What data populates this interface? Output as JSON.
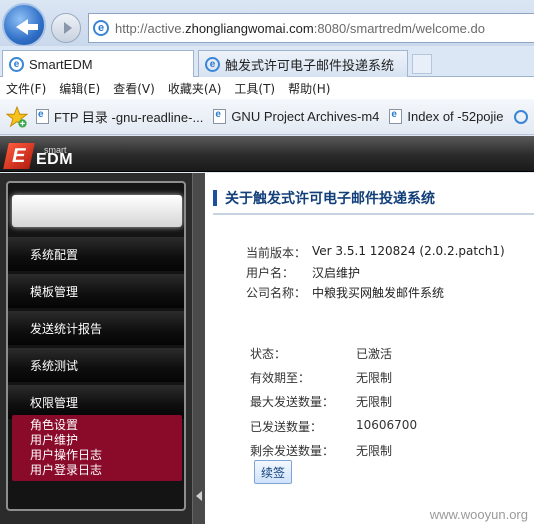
{
  "browser": {
    "url_prefix": "http://active.",
    "url_host": "zhongliangwomai.com",
    "url_suffix": ":8080/smartredm/welcome.do",
    "tabs": [
      {
        "label": "SmartEDM"
      },
      {
        "label": "触发式许可电子邮件投递系统"
      }
    ],
    "menu": [
      "文件(F)",
      "编辑(E)",
      "查看(V)",
      "收藏夹(A)",
      "工具(T)",
      "帮助(H)"
    ],
    "favorites": [
      {
        "label": "FTP 目录 -gnu-readline-..."
      },
      {
        "label": "GNU Project Archives-m4"
      },
      {
        "label": "Index of -52pojie"
      }
    ]
  },
  "header": {
    "logo_small": "smart",
    "logo_big": "EDM",
    "logo_mark": "E"
  },
  "sidebar": {
    "items": [
      {
        "label": "系统配置"
      },
      {
        "label": "模板管理"
      },
      {
        "label": "发送统计报告"
      },
      {
        "label": "系统测试"
      },
      {
        "label": "权限管理"
      }
    ],
    "subitems": [
      {
        "label": "角色设置"
      },
      {
        "label": "用户维护"
      },
      {
        "label": "用户操作日志"
      },
      {
        "label": "用户登录日志"
      }
    ]
  },
  "main": {
    "title": "关于触发式许可电子邮件投递系统",
    "info": [
      {
        "label": "当前版本：",
        "value": "Ver 3.5.1 120824 (2.0.2.patch1)"
      },
      {
        "label": "用户名：",
        "value": "汉启维护"
      },
      {
        "label": "公司名称：",
        "value": "中粮我买网触发邮件系统"
      }
    ],
    "status": [
      {
        "label": "状态：",
        "value": "已激活"
      },
      {
        "label": "有效期至：",
        "value": "无限制"
      },
      {
        "label": "最大发送数量：",
        "value": "无限制"
      },
      {
        "label": "已发送数量：",
        "value": "10606700"
      },
      {
        "label": "剩余发送数量：",
        "value": "无限制"
      }
    ],
    "renew_label": "续签"
  },
  "watermark": "www.wooyun.org"
}
